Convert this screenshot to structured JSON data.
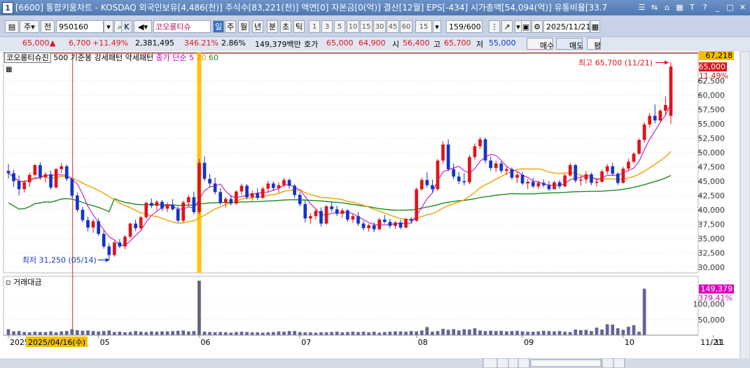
{
  "title_bar": {
    "number": "1",
    "text": "[6600] 통합키움차트 - KOSDAQ 외국인보유[4,486(천)] 주식수[83,221(천)] 액면[0] 자본금[0(억)] 결산[12월] EPS[-434] 시가총액[54,094(억)] 유통비율[33.7"
  },
  "toolbar": {
    "type_ju": "주",
    "jeon": "전",
    "code": "950160",
    "k": "K",
    "item_name": "코오롱티슈",
    "periods": [
      "일",
      "주",
      "월",
      "년",
      "분",
      "초",
      "틱"
    ],
    "intervals": [
      "1",
      "3",
      "5",
      "10",
      "15",
      "30",
      "45",
      "60"
    ],
    "interval_value": "15",
    "count": "159/600",
    "date": "2025/11/21"
  },
  "quote": {
    "price": "65,000",
    "change": "6,700",
    "change_pct": "+11.49%",
    "volume": "2,381,495",
    "vol_ratio": "346.21%",
    "turnover": "2.86%",
    "amount": "149,379백만",
    "label_hoga": "호가",
    "ask": "65,000",
    "bid": "64,900",
    "label_open": "시",
    "open": "56,400",
    "label_high": "고",
    "high": "65,700",
    "label_low": "저",
    "low": "55,000",
    "buy": "매수",
    "sell": "매도",
    "flat": "평"
  },
  "legend": {
    "name": "코오롱티슈진",
    "line1": "500 기준봉 강세패턴",
    "line2": "약세패턴",
    "ma_label": "종가 단순",
    "ma5": "5",
    "ma20": "20",
    "ma60": "60",
    "volume_title": "거래대금"
  },
  "annotations": {
    "high": "최고 65,700 (11/21)",
    "low": "최저 31,250 (05/14)"
  },
  "axis": {
    "price_ticks": [
      "62,500",
      "60,000",
      "57,500",
      "55,000",
      "52,500",
      "50,000",
      "47,500",
      "45,000",
      "42,500",
      "40,000",
      "37,500",
      "35,000",
      "32,500",
      "30,000"
    ],
    "top_value": "67,218",
    "current_label": "65,000",
    "pct_label": "11.49%",
    "vol_ticks": [
      "100,000",
      "50,000"
    ],
    "vol_current": "149,379",
    "vol_pct": "379.41%",
    "x_labels": [
      {
        "text": "2025",
        "i": 0
      },
      {
        "text": "05",
        "i": 17
      },
      {
        "text": "06",
        "i": 36
      },
      {
        "text": "07",
        "i": 55
      },
      {
        "text": "08",
        "i": 77
      },
      {
        "text": "09",
        "i": 97
      },
      {
        "text": "10",
        "i": 116
      },
      {
        "text": "11",
        "i": 133
      }
    ],
    "selected_date": "2025/04/16(수)",
    "right_date": "11/21"
  },
  "colors": {
    "up": "#e0141a",
    "down": "#1434c8",
    "ma5": "#c000c0",
    "ma20": "#f0a000",
    "ma60": "#208a20",
    "vol": "#64649a",
    "highlight": "#ffc000"
  },
  "chart_data": {
    "type": "candlestick",
    "ylim": [
      29000,
      67218
    ],
    "candles": [
      [
        46800,
        48000,
        45500,
        46400
      ],
      [
        46400,
        47000,
        44000,
        45000
      ],
      [
        45000,
        46000,
        42500,
        43600
      ],
      [
        43600,
        45200,
        43000,
        44800
      ],
      [
        44800,
        46500,
        44000,
        46100
      ],
      [
        46100,
        48000,
        45800,
        47800
      ],
      [
        47800,
        48300,
        45200,
        45700
      ],
      [
        45700,
        46600,
        44800,
        46200
      ],
      [
        46200,
        46800,
        43500,
        43900
      ],
      [
        43900,
        47300,
        43700,
        47100
      ],
      [
        47100,
        48200,
        46400,
        47600
      ],
      [
        47600,
        47900,
        45000,
        45400
      ],
      [
        45400,
        45600,
        42100,
        42500
      ],
      [
        42500,
        43000,
        39600,
        40000
      ],
      [
        40000,
        40500,
        37800,
        38200
      ],
      [
        38200,
        38800,
        36300,
        36900
      ],
      [
        36900,
        38400,
        36000,
        38000
      ],
      [
        38000,
        38500,
        35400,
        35800
      ],
      [
        35800,
        36400,
        33200,
        33600
      ],
      [
        33600,
        34100,
        31250,
        32100
      ],
      [
        32100,
        34600,
        31800,
        34300
      ],
      [
        34300,
        34900,
        33300,
        33600
      ],
      [
        33600,
        35600,
        33100,
        35300
      ],
      [
        35300,
        37800,
        35000,
        37600
      ],
      [
        37600,
        38300,
        36300,
        36800
      ],
      [
        36800,
        38900,
        36500,
        38700
      ],
      [
        38700,
        41500,
        38400,
        41200
      ],
      [
        41200,
        42000,
        40300,
        40700
      ],
      [
        40700,
        41700,
        40000,
        41400
      ],
      [
        41400,
        41700,
        39800,
        40200
      ],
      [
        40200,
        41300,
        39600,
        40900
      ],
      [
        40900,
        41900,
        39800,
        40100
      ],
      [
        40100,
        40600,
        37800,
        38100
      ],
      [
        38100,
        41600,
        37800,
        41300
      ],
      [
        41300,
        42600,
        40500,
        42200
      ],
      [
        42200,
        43200,
        39200,
        39600
      ],
      [
        39600,
        48900,
        39200,
        48200
      ],
      [
        48200,
        49300,
        45000,
        45400
      ],
      [
        45400,
        46300,
        44000,
        44600
      ],
      [
        44600,
        45600,
        42700,
        43100
      ],
      [
        43100,
        43800,
        40900,
        41200
      ],
      [
        41200,
        42300,
        40400,
        41900
      ],
      [
        41900,
        42600,
        40800,
        41100
      ],
      [
        41100,
        43400,
        40900,
        43200
      ],
      [
        43200,
        44600,
        42600,
        44200
      ],
      [
        44200,
        44500,
        41800,
        42200
      ],
      [
        42200,
        43400,
        41600,
        42900
      ],
      [
        42900,
        43800,
        41700,
        42100
      ],
      [
        42100,
        44100,
        41900,
        43700
      ],
      [
        43700,
        45100,
        43100,
        44600
      ],
      [
        44600,
        45000,
        43300,
        43800
      ],
      [
        43800,
        44800,
        43000,
        44300
      ],
      [
        44300,
        45600,
        43900,
        45200
      ],
      [
        45200,
        45500,
        43700,
        44200
      ],
      [
        44200,
        44500,
        42100,
        42600
      ],
      [
        42600,
        43100,
        40600,
        41000
      ],
      [
        41000,
        41600,
        37800,
        38500
      ],
      [
        38500,
        39400,
        37600,
        38900
      ],
      [
        38900,
        40200,
        38300,
        39800
      ],
      [
        39800,
        40400,
        37100,
        37600
      ],
      [
        37600,
        40900,
        37400,
        40600
      ],
      [
        40600,
        41400,
        39700,
        40100
      ],
      [
        40100,
        40700,
        38900,
        39300
      ],
      [
        39300,
        40300,
        38600,
        39900
      ],
      [
        39900,
        40100,
        37900,
        38300
      ],
      [
        38300,
        39300,
        37700,
        38900
      ],
      [
        38900,
        39600,
        37200,
        37600
      ],
      [
        37600,
        38100,
        36400,
        36800
      ],
      [
        36800,
        37600,
        36200,
        37300
      ],
      [
        37300,
        37800,
        36100,
        36600
      ],
      [
        36600,
        38600,
        36400,
        38300
      ],
      [
        38300,
        39100,
        37600,
        37900
      ],
      [
        37900,
        38400,
        36800,
        37200
      ],
      [
        37200,
        38100,
        36700,
        37800
      ],
      [
        37800,
        38300,
        36600,
        36900
      ],
      [
        36900,
        38600,
        36800,
        38400
      ],
      [
        38400,
        38700,
        37600,
        38100
      ],
      [
        38100,
        43900,
        37900,
        43600
      ],
      [
        43600,
        45600,
        43300,
        45200
      ],
      [
        45200,
        46600,
        43900,
        44300
      ],
      [
        44300,
        45300,
        42900,
        43600
      ],
      [
        43600,
        48900,
        43300,
        48600
      ],
      [
        48600,
        52000,
        48000,
        51400
      ],
      [
        51400,
        52300,
        46700,
        47100
      ],
      [
        47100,
        48100,
        45300,
        45800
      ],
      [
        45800,
        46600,
        44500,
        45000
      ],
      [
        45000,
        46400,
        44300,
        44800
      ],
      [
        44800,
        49600,
        44500,
        49200
      ],
      [
        49200,
        51600,
        48700,
        51100
      ],
      [
        51100,
        52700,
        50600,
        52300
      ],
      [
        52300,
        52600,
        48100,
        48600
      ],
      [
        48600,
        49300,
        46800,
        47300
      ],
      [
        47300,
        48600,
        46600,
        48100
      ],
      [
        48100,
        48500,
        46400,
        46800
      ],
      [
        46800,
        47600,
        46100,
        47100
      ],
      [
        47100,
        47400,
        45200,
        45600
      ],
      [
        45600,
        46600,
        44700,
        46100
      ],
      [
        46100,
        46600,
        44300,
        44600
      ],
      [
        44600,
        45400,
        43600,
        44900
      ],
      [
        44900,
        45600,
        43800,
        44100
      ],
      [
        44100,
        45100,
        43600,
        44700
      ],
      [
        44700,
        45300,
        43900,
        44300
      ],
      [
        44300,
        45000,
        43300,
        43600
      ],
      [
        43600,
        45100,
        43500,
        44800
      ],
      [
        44800,
        45200,
        43700,
        44100
      ],
      [
        44100,
        46300,
        43900,
        46000
      ],
      [
        46000,
        48200,
        45800,
        47800
      ],
      [
        47800,
        48000,
        44700,
        45100
      ],
      [
        45100,
        45900,
        44200,
        45300
      ],
      [
        45300,
        46800,
        44600,
        46200
      ],
      [
        46200,
        46500,
        44300,
        44700
      ],
      [
        44700,
        45500,
        44000,
        44900
      ],
      [
        44900,
        47000,
        44700,
        46700
      ],
      [
        46700,
        48000,
        46200,
        47600
      ],
      [
        47600,
        48200,
        45900,
        46300
      ],
      [
        46300,
        46600,
        44300,
        44700
      ],
      [
        44700,
        47500,
        44600,
        47200
      ],
      [
        47200,
        48900,
        46900,
        48400
      ],
      [
        48400,
        50000,
        48100,
        49800
      ],
      [
        49800,
        52500,
        49600,
        52200
      ],
      [
        52200,
        55300,
        51700,
        54900
      ],
      [
        54900,
        56900,
        54400,
        56400
      ],
      [
        56400,
        58400,
        55100,
        55600
      ],
      [
        55600,
        57600,
        55400,
        57300
      ],
      [
        57300,
        59800,
        56500,
        58300
      ],
      [
        56400,
        65700,
        55000,
        65000
      ]
    ],
    "volume_amounts": [
      19000,
      12000,
      13000,
      10000,
      9000,
      11000,
      10000,
      10000,
      12000,
      9000,
      12000,
      13000,
      19000,
      16000,
      14000,
      15000,
      13000,
      12000,
      13000,
      15000,
      10000,
      11000,
      9000,
      10000,
      13000,
      11000,
      10000,
      12000,
      11000,
      12000,
      12000,
      13000,
      14000,
      15000,
      12000,
      13000,
      175000,
      11000,
      10000,
      9000,
      10000,
      9000,
      8000,
      10000,
      11000,
      10000,
      9000,
      9000,
      8000,
      9000,
      10000,
      12000,
      11000,
      13000,
      13000,
      10000,
      9000,
      9000,
      8000,
      9000,
      9000,
      10000,
      11000,
      9000,
      10000,
      11000,
      10000,
      11000,
      9000,
      11000,
      8000,
      10000,
      11000,
      12000,
      12000,
      11000,
      13000,
      12000,
      15000,
      26000,
      11000,
      13000,
      20000,
      17000,
      19000,
      15000,
      19000,
      18000,
      22000,
      15000,
      13000,
      14000,
      13000,
      14000,
      12000,
      13000,
      14000,
      12000,
      11000,
      11000,
      12000,
      14000,
      13000,
      12000,
      13000,
      11000,
      10000,
      18000,
      16000,
      17000,
      13000,
      24000,
      18000,
      35000,
      34000,
      22000,
      17000,
      27000,
      32000,
      11000,
      149379
    ],
    "ma5": [],
    "ma20": [],
    "ma60": []
  }
}
